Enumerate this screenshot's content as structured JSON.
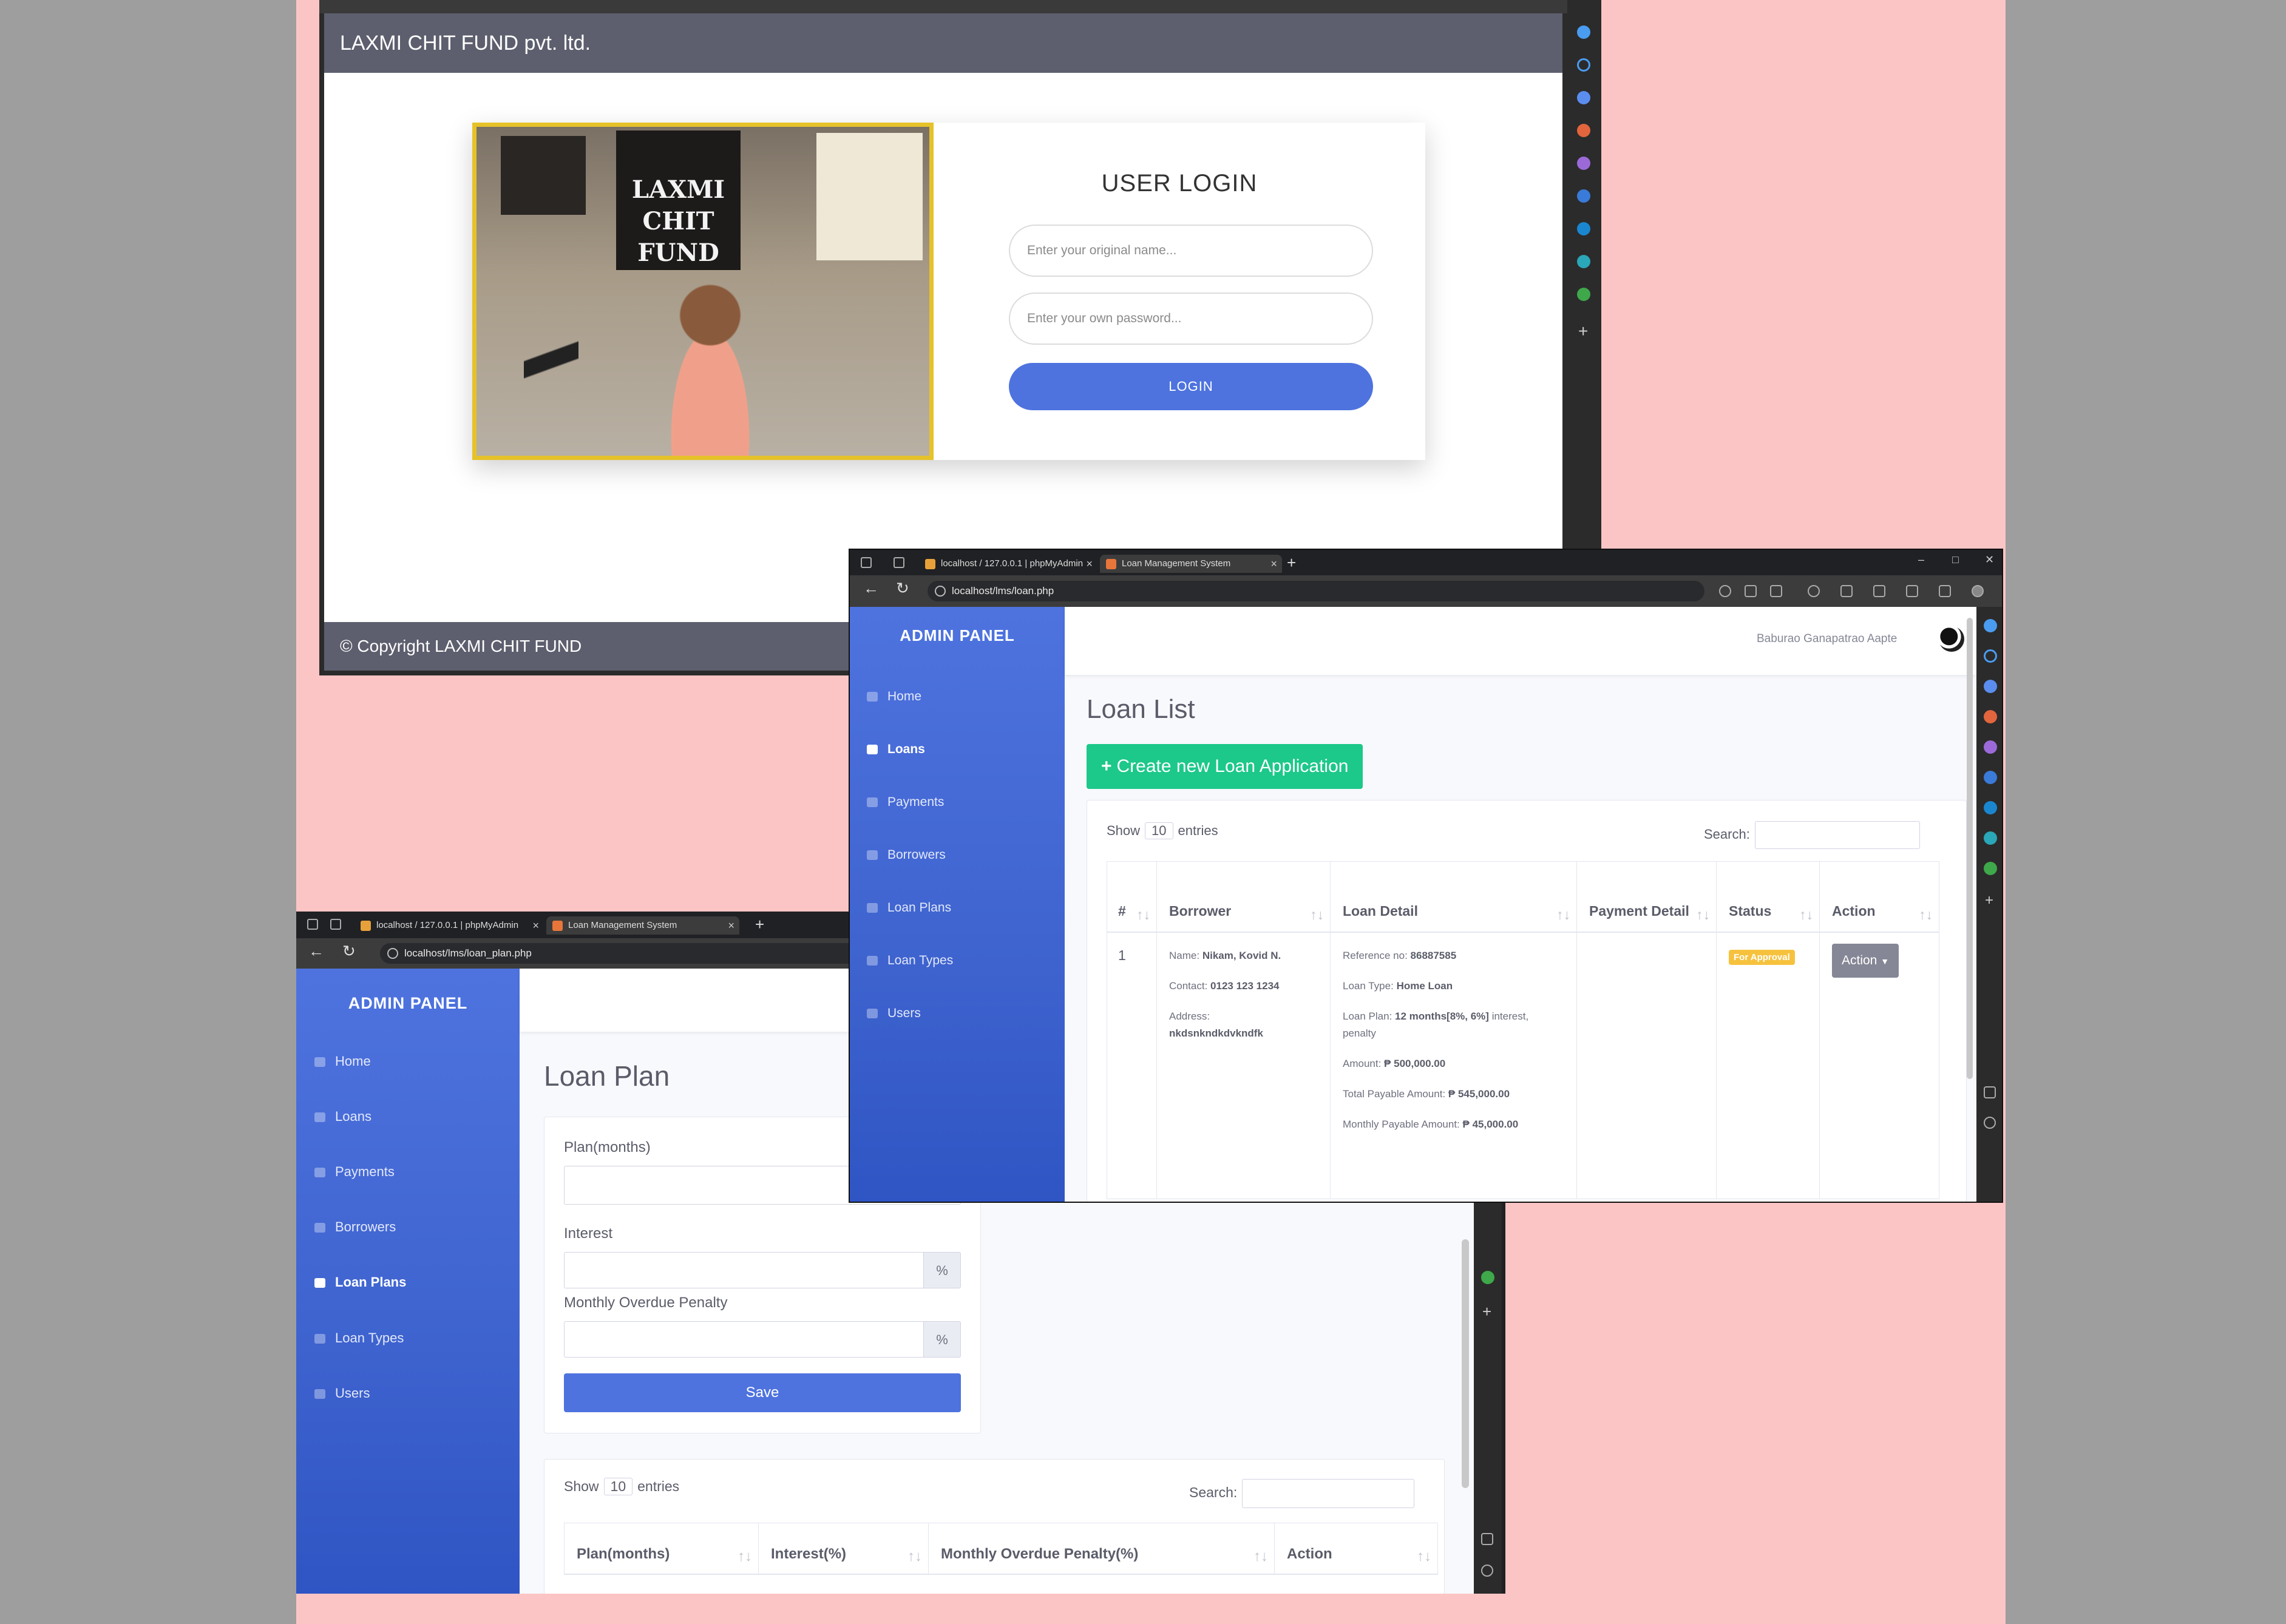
{
  "login_window": {
    "brand": "LAXMI CHIT FUND pvt. ltd.",
    "photo_sign": "LAXMI CHIT FUND",
    "form_title": "USER LOGIN",
    "username_placeholder": "Enter your original name...",
    "password_placeholder": "Enter your own password...",
    "login_button": "LOGIN",
    "footer": "© Copyright LAXMI CHIT FUND",
    "colors": {
      "brand_bar": "#5d5f6e",
      "login_button": "#4e73df",
      "photo_frame": "#e6c22a"
    }
  },
  "plan_window": {
    "tabs": [
      {
        "label": "localhost / 127.0.0.1 | phpMyAdmin",
        "icon": "phpmyadmin-icon"
      },
      {
        "label": "Loan Management System",
        "icon": "app-favicon"
      }
    ],
    "url": "localhost/lms/loan_plan.php",
    "sidebar": {
      "title": "ADMIN PANEL",
      "items": [
        {
          "label": "Home",
          "icon": "home-icon",
          "active": false
        },
        {
          "label": "Loans",
          "icon": "loans-icon",
          "active": false
        },
        {
          "label": "Payments",
          "icon": "payments-icon",
          "active": false
        },
        {
          "label": "Borrowers",
          "icon": "borrowers-icon",
          "active": false
        },
        {
          "label": "Loan Plans",
          "icon": "loan-plans-icon",
          "active": true
        },
        {
          "label": "Loan Types",
          "icon": "loan-types-icon",
          "active": false
        },
        {
          "label": "Users",
          "icon": "users-icon",
          "active": false
        }
      ]
    },
    "page_title": "Loan Plan",
    "form": {
      "plan_label": "Plan(months)",
      "interest_label": "Interest",
      "interest_addon": "%",
      "penalty_label": "Monthly Overdue Penalty",
      "penalty_addon": "%",
      "save_button": "Save"
    },
    "table": {
      "show_label": "Show",
      "entries_value": "10",
      "entries_label": "entries",
      "search_label": "Search:",
      "columns": [
        "Plan(months)",
        "Interest(%)",
        "Monthly Overdue Penalty(%)",
        "Action"
      ]
    }
  },
  "list_window": {
    "tabs": [
      {
        "label": "localhost / 127.0.0.1 | phpMyAdmin",
        "icon": "phpmyadmin-icon"
      },
      {
        "label": "Loan Management System",
        "icon": "app-favicon"
      }
    ],
    "url": "localhost/lms/loan.php",
    "user_name": "Baburao Ganapatrao Aapte",
    "sidebar": {
      "title": "ADMIN PANEL",
      "items": [
        {
          "label": "Home",
          "icon": "home-icon",
          "active": false
        },
        {
          "label": "Loans",
          "icon": "loans-icon",
          "active": true
        },
        {
          "label": "Payments",
          "icon": "payments-icon",
          "active": false
        },
        {
          "label": "Borrowers",
          "icon": "borrowers-icon",
          "active": false
        },
        {
          "label": "Loan Plans",
          "icon": "loan-plans-icon",
          "active": false
        },
        {
          "label": "Loan Types",
          "icon": "loan-types-icon",
          "active": false
        },
        {
          "label": "Users",
          "icon": "users-icon",
          "active": false
        }
      ]
    },
    "page_title": "Loan List",
    "create_button": "Create new Loan Application",
    "table": {
      "show_label": "Show",
      "entries_value": "10",
      "entries_label": "entries",
      "search_label": "Search:",
      "columns": [
        "#",
        "Borrower",
        "Loan Detail",
        "Payment Detail",
        "Status",
        "Action"
      ],
      "rows": [
        {
          "index": "1",
          "borrower": [
            {
              "k": "Name:",
              "v": "Nikam, Kovid N."
            },
            {
              "k": "Contact:",
              "v": "0123 123 1234"
            },
            {
              "k": "Address:",
              "v": "nkdsnkndkdvkndfk"
            }
          ],
          "loan_detail": [
            {
              "k": "Reference no:",
              "v": "86887585",
              "tail": ""
            },
            {
              "k": "Loan Type:",
              "v": "Home Loan",
              "tail": ""
            },
            {
              "k": "Loan Plan:",
              "v": "12 months[8%, 6%]",
              "tail": "interest, penalty"
            },
            {
              "k": "Amount:",
              "v": "₱ 500,000.00",
              "tail": ""
            },
            {
              "k": "Total Payable Amount:",
              "v": "₱ 545,000.00",
              "tail": ""
            },
            {
              "k": "Monthly Payable Amount:",
              "v": "₱ 45,000.00",
              "tail": ""
            }
          ],
          "payment_detail": "",
          "status": "For Approval",
          "action": "Action"
        }
      ]
    },
    "colors": {
      "create_button": "#1cc88a",
      "status_badge": "#f6c23e",
      "action_button": "#858796",
      "sidebar": "#4e73df"
    }
  }
}
